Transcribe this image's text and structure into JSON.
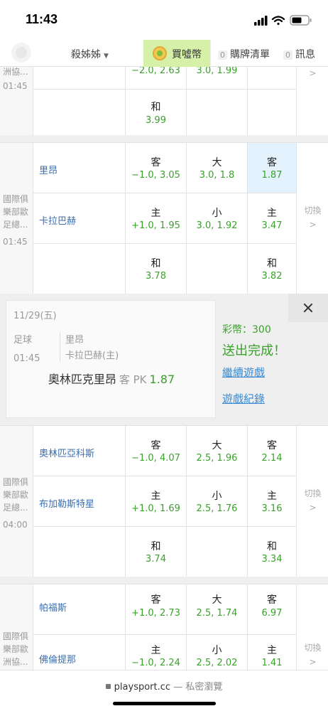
{
  "status_bar": {
    "time": "11:43"
  },
  "nav": {
    "user": "殺姊姊",
    "buy": "買噓幣",
    "cart_count": "0",
    "cart": "購牌清單",
    "msg_count": "0",
    "msg": "訊息"
  },
  "swap_label": "切換",
  "board0": {
    "left": [
      "洲協..."
    ],
    "time": "01:45",
    "rows": [
      {
        "team": "",
        "c1": {
          "top": "",
          "bot": "−2.0, 2.63"
        },
        "c2": {
          "top": "",
          "bot": "3.0, 1.99"
        }
      },
      {
        "team": "",
        "c1": {
          "top": "和",
          "bot": "3.99"
        }
      }
    ]
  },
  "board1": {
    "left": [
      "國際俱",
      "樂部歐",
      "足總..."
    ],
    "time": "01:45",
    "rows": [
      {
        "team": "里昂",
        "c1": {
          "top": "客",
          "bot": "−1.0, 3.05"
        },
        "c2": {
          "top": "大",
          "bot": "3.0, 1.8"
        },
        "c3": {
          "top": "客",
          "bot": "1.87"
        }
      },
      {
        "team": "卡拉巴赫",
        "c1": {
          "top": "主",
          "bot": "+1.0, 1.95"
        },
        "c2": {
          "top": "小",
          "bot": "3.0, 1.92"
        },
        "c3": {
          "top": "主",
          "bot": "3.47"
        }
      },
      {
        "team": "",
        "c1": {
          "top": "和",
          "bot": "3.78"
        },
        "c3": {
          "top": "和",
          "bot": "3.82"
        }
      }
    ]
  },
  "ticket": {
    "date": "11/29(五)",
    "sport": "足球",
    "time": "01:45",
    "team1": "里昂",
    "team2": "卡拉巴赫(主)",
    "pick": "奧林匹克里昂",
    "pick_kind": "客 PK",
    "pick_odds": "1.87",
    "coins": "彩幣：300",
    "done": "送出完成！",
    "continue": "繼續遊戲",
    "history": "遊戲紀錄"
  },
  "board2": {
    "left": [
      "國際俱",
      "樂部歐",
      "足總..."
    ],
    "time": "04:00",
    "rows": [
      {
        "team": "奧林匹亞科斯",
        "c1": {
          "top": "客",
          "bot": "−1.0, 4.07"
        },
        "c2": {
          "top": "大",
          "bot": "2.5, 1.96"
        },
        "c3": {
          "top": "客",
          "bot": "2.14"
        }
      },
      {
        "team": "布加勒斯特星",
        "c1": {
          "top": "主",
          "bot": "+1.0, 1.69"
        },
        "c2": {
          "top": "小",
          "bot": "2.5, 1.76"
        },
        "c3": {
          "top": "主",
          "bot": "3.16"
        }
      },
      {
        "team": "",
        "c1": {
          "top": "和",
          "bot": "3.74"
        },
        "c3": {
          "top": "和",
          "bot": "3.34"
        }
      }
    ]
  },
  "board3": {
    "left": [
      "國際俱",
      "樂部歐",
      "洲協..."
    ],
    "rows": [
      {
        "team": "帕福斯",
        "c1": {
          "top": "客",
          "bot": "+1.0, 2.73"
        },
        "c2": {
          "top": "大",
          "bot": "2.5, 1.74"
        },
        "c3": {
          "top": "客",
          "bot": "6.97"
        }
      },
      {
        "team": "佛倫提那",
        "c1": {
          "top": "主",
          "bot": "−1.0, 2.24"
        },
        "c2": {
          "top": "小",
          "bot": "2.5, 2.02"
        },
        "c3": {
          "top": "主",
          "bot": "1.41"
        }
      }
    ]
  },
  "browser": {
    "domain": "playsport.cc",
    "mode": "— 私密瀏覽"
  },
  "colors": {
    "odds_green": "#3aa12b",
    "team_blue": "#3a6fb0",
    "buy_bg": "#d7f0a8",
    "selected_bg": "#e3f2fc"
  }
}
